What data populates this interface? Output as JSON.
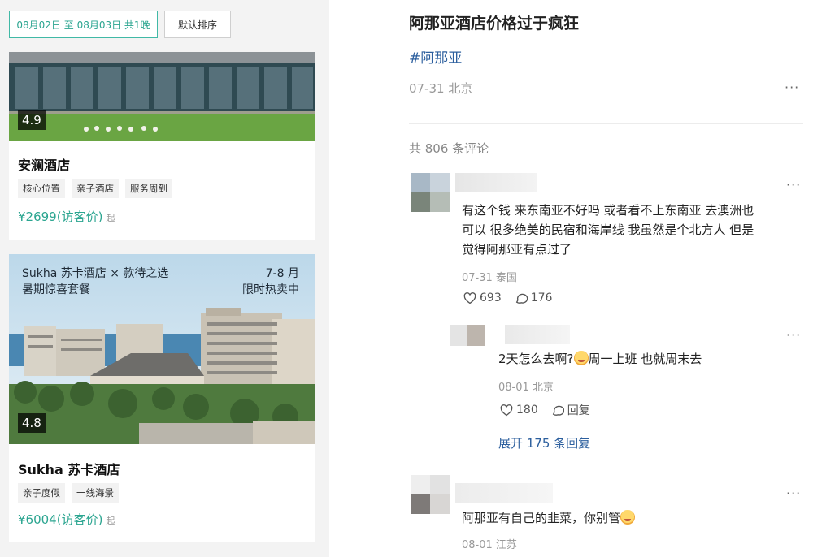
{
  "filters": {
    "date_range": "08月02日 至 08月03日 共1晚",
    "sort_label": "默认排序"
  },
  "hotels": [
    {
      "rating": "4.9",
      "name": "安澜酒店",
      "tags": [
        "核心位置",
        "亲子酒店",
        "服务周到"
      ],
      "price": "¥2699(访客价)",
      "price_suffix": "起"
    },
    {
      "rating": "4.8",
      "name": "Sukha 苏卡酒店",
      "tags": [
        "亲子度假",
        "一线海景"
      ],
      "price": "¥6004(访客价)",
      "price_suffix": "起",
      "promo_left": [
        "Sukha 苏卡酒店 × 款待之选",
        "暑期惊喜套餐"
      ],
      "promo_right": [
        "7-8 月",
        "限时热卖中"
      ]
    }
  ],
  "post": {
    "title": "阿那亚酒店价格过于疯狂",
    "hashtag": "#阿那亚",
    "meta": "07-31 北京",
    "comments_count": "共 806 条评论"
  },
  "comments": [
    {
      "text_lines": [
        "有这个钱 来东南亚不好吗 或者看不上东南亚 去澳洲也",
        "可以 很多绝美的民宿和海岸线 我虽然是个北方人 但是",
        "觉得阿那亚有点过了"
      ],
      "meta": "07-31 泰国",
      "likes": "693",
      "replies": "176"
    },
    {
      "text_a": "2天怎么去啊?",
      "text_b": "周一上班 也就周末去",
      "meta": "08-01 北京",
      "likes": "180",
      "reply_label": "回复",
      "expand": "展开 175 条回复"
    },
    {
      "text": "阿那亚有自己的韭菜，你别管",
      "meta": "08-01 江苏"
    }
  ],
  "icons": {
    "more": "more-dots-icon",
    "like": "heart-icon",
    "comment": "comment-bubble-icon",
    "emoji": "emoji-face-icon"
  },
  "colors": {
    "accent_teal": "#2ba590",
    "link_blue": "#2c5f9e",
    "muted_gray": "#999999"
  }
}
